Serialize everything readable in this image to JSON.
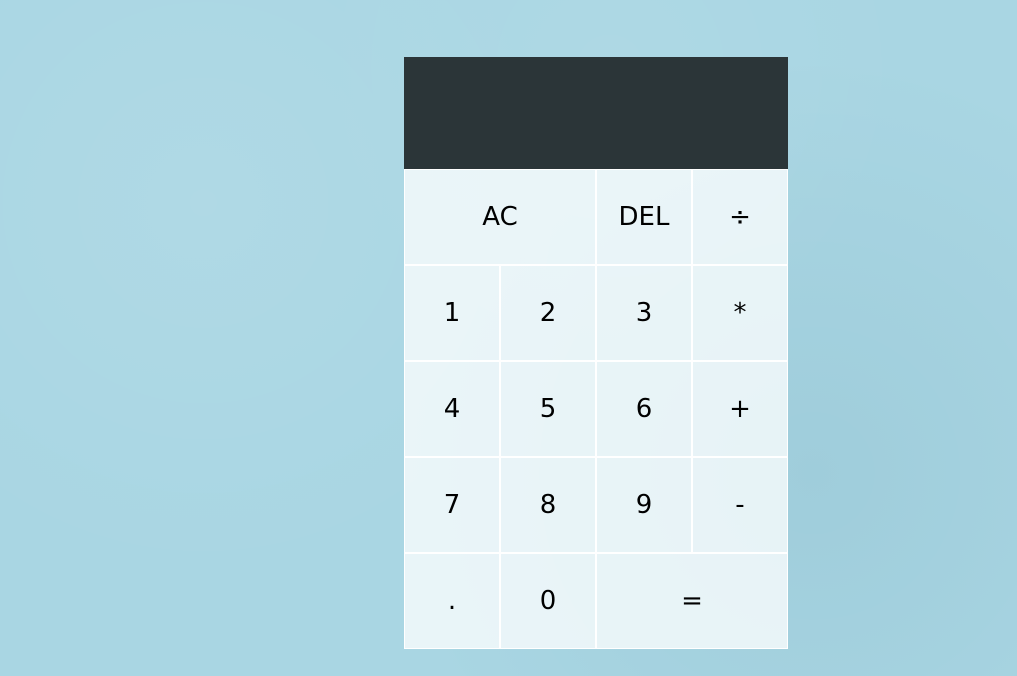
{
  "display": {
    "previous_operand": "",
    "current_operand": ""
  },
  "keys": {
    "all_clear": "AC",
    "delete": "DEL",
    "divide": "÷",
    "one": "1",
    "two": "2",
    "three": "3",
    "multiply": "*",
    "four": "4",
    "five": "5",
    "six": "6",
    "add": "+",
    "seven": "7",
    "eight": "8",
    "nine": "9",
    "subtract": "-",
    "decimal": ".",
    "zero": "0",
    "equals": "="
  },
  "colors": {
    "background": "#a9d6e3",
    "display_background": "#2b3538",
    "key_background": "#e8f4f7",
    "key_border": "#ffffff",
    "key_text": "#000000"
  }
}
